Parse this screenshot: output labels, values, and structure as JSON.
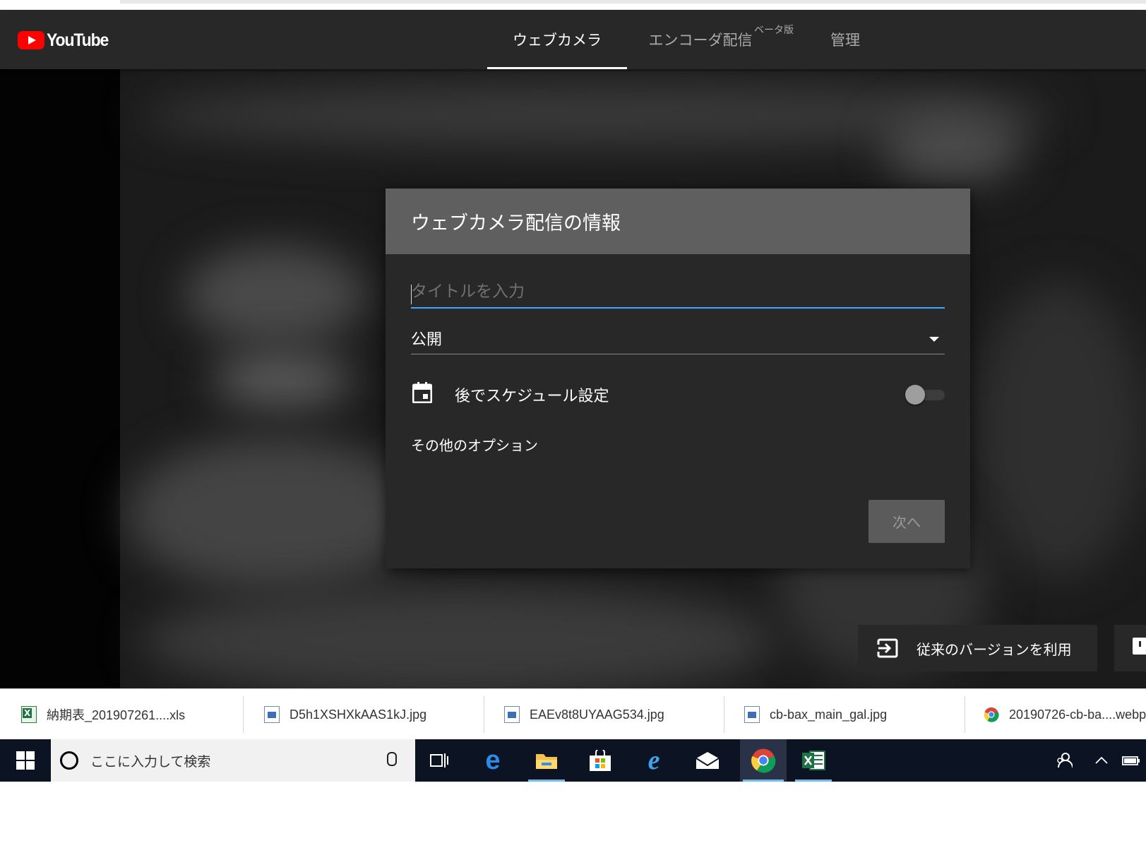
{
  "header": {
    "logo_text": "YouTube",
    "tabs": [
      {
        "label": "ウェブカメラ",
        "active": true
      },
      {
        "label": "エンコーダ配信",
        "active": false
      },
      {
        "label": "管理",
        "active": false
      }
    ],
    "beta_label": "ベータ版"
  },
  "dialog": {
    "title": "ウェブカメラ配信の情報",
    "title_placeholder": "タイトルを入力",
    "privacy_value": "公開",
    "schedule_label": "後でスケジュール設定",
    "schedule_enabled": false,
    "more_options": "その他のオプション",
    "next_button": "次へ"
  },
  "legacy_button": "従来のバージョンを利用",
  "downloads": [
    {
      "name": "納期表_201907261....xls",
      "icon": "excel-file-icon"
    },
    {
      "name": "D5h1XSHXkAAS1kJ.jpg",
      "icon": "image-file-icon"
    },
    {
      "name": "EAEv8t8UYAAG534.jpg",
      "icon": "image-file-icon"
    },
    {
      "name": "cb-bax_main_gal.jpg",
      "icon": "image-file-icon"
    },
    {
      "name": "20190726-cb-ba....webp",
      "icon": "chrome-icon"
    }
  ],
  "taskbar": {
    "search_placeholder": "ここに入力して検索",
    "apps": [
      "task-view-icon",
      "edge-icon",
      "file-explorer-icon",
      "store-icon",
      "internet-explorer-icon",
      "mail-icon",
      "chrome-icon",
      "excel-icon"
    ]
  },
  "colors": {
    "accent": "#3ea6ff",
    "youtube_red": "#ff0000",
    "header_bg": "#282828",
    "dialog_head": "#5f5f5f"
  }
}
